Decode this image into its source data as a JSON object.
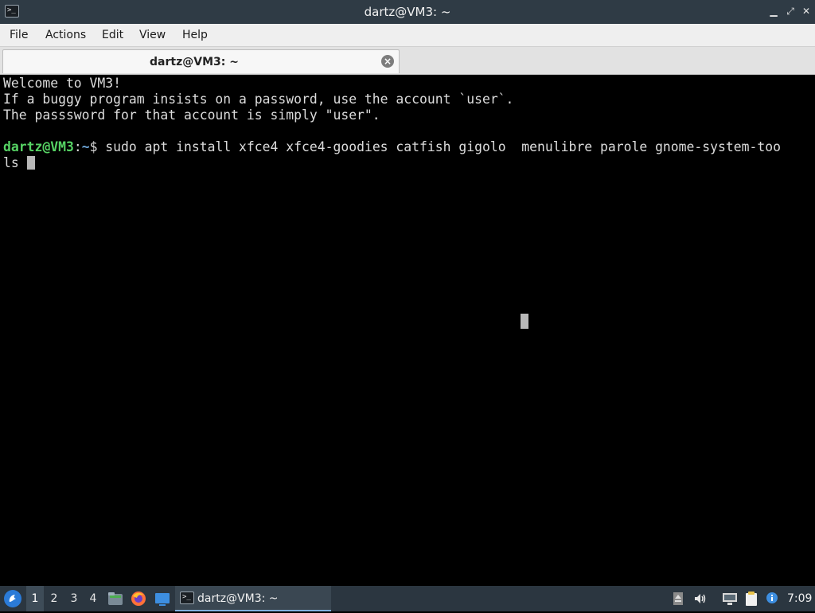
{
  "window": {
    "title": "dartz@VM3: ~",
    "app_icon_glyph": ">_",
    "minimize_glyph": "▁",
    "maximize_glyph": "⤢",
    "close_glyph": "✕"
  },
  "menubar": {
    "items": [
      {
        "label": "File"
      },
      {
        "label": "Actions"
      },
      {
        "label": "Edit"
      },
      {
        "label": "View"
      },
      {
        "label": "Help"
      }
    ]
  },
  "tabs": [
    {
      "label": "dartz@VM3: ~",
      "active": true,
      "close_glyph": "×"
    }
  ],
  "terminal": {
    "lines": [
      "Welcome to VM3!",
      "If a buggy program insists on a password, use the account `user`.",
      "The passsword for that account is simply \"user\".",
      ""
    ],
    "prompt": {
      "user_host": "dartz@VM3",
      "separator": ":",
      "path": "~",
      "symbol": "$",
      "command_line1": " sudo apt install xfce4 xfce4-goodies catfish gigolo  menulibre parole gnome-system-too",
      "command_line2": "ls "
    }
  },
  "taskbar": {
    "workspaces": [
      "1",
      "2",
      "3",
      "4"
    ],
    "active_workspace": "1",
    "task_label": "dartz@VM3: ~",
    "clock": "7:09",
    "start_icon_name": "start-menu-icon"
  },
  "colors": {
    "terminal_bg": "#000000",
    "terminal_fg": "#dcdcdc",
    "prompt_user": "#56d364",
    "prompt_path": "#6fa8dc",
    "titlebar_bg": "#2f3b45",
    "taskbar_bg": "#2b3640"
  }
}
